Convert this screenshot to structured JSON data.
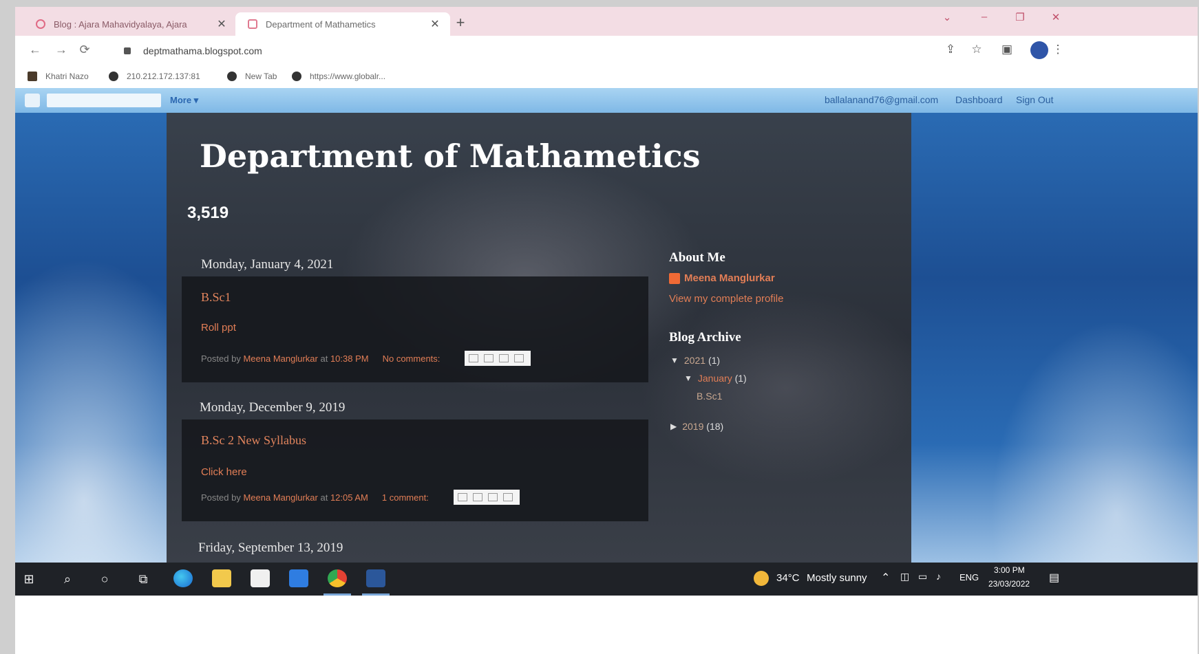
{
  "browser": {
    "tabs": [
      {
        "title": "Blog : Ajara Mahavidyalaya, Ajara",
        "close": "✕"
      },
      {
        "title": "Department of Mathametics",
        "close": "✕"
      }
    ],
    "new_tab": "+",
    "window_controls": {
      "dropdown": "⌄",
      "minimize": "–",
      "maximize": "❐",
      "close": "✕"
    },
    "address": "deptmathama.blogspot.com",
    "nav": {
      "back": "←",
      "forward": "→",
      "reload": "⟳"
    },
    "toolbar_icons": {
      "share": "⇪",
      "star": "☆",
      "sidepanel": "▣",
      "menu": "⋮"
    },
    "bookmarks": [
      {
        "label": "Khatri Nazo"
      },
      {
        "label": "210.212.172.137:81"
      },
      {
        "label": "New Tab"
      },
      {
        "label": "https://www.globalr..."
      }
    ]
  },
  "blogger_nav": {
    "more": "More ▾",
    "email": "ballalanand76@gmail.com",
    "dashboard": "Dashboard",
    "sign_out": "Sign Out"
  },
  "blog": {
    "title": "Department of Mathametics",
    "counter": "3,519",
    "posts": [
      {
        "date": "Monday, January 4, 2021",
        "title": "B.Sc1",
        "body": "Roll ppt",
        "posted_by": "Posted by",
        "author": "Meena Manglurkar",
        "at": "at",
        "time": "10:38 PM",
        "comments": "No comments:"
      },
      {
        "date": "Monday, December 9, 2019",
        "title": "B.Sc 2 New Syllabus",
        "body": "Click here",
        "posted_by": "Posted by",
        "author": "Meena Manglurkar",
        "at": "at",
        "time": "12:05 AM",
        "comments": "1 comment:"
      },
      {
        "date": "Friday, September 13, 2019"
      }
    ],
    "sidebar": {
      "about_heading": "About Me",
      "profile_name": "Meena Manglurkar",
      "view_profile": "View my complete profile",
      "archive_heading": "Blog Archive",
      "archive": {
        "y2021": "2021",
        "y2021_count": "(1)",
        "jan": "January",
        "jan_count": "(1)",
        "post": "B.Sc1",
        "y2019": "2019",
        "y2019_count": "(18)"
      }
    }
  },
  "taskbar": {
    "temperature": "34°C",
    "weather": "Mostly sunny",
    "language": "ENG",
    "time": "3:00 PM",
    "date": "23/03/2022"
  }
}
